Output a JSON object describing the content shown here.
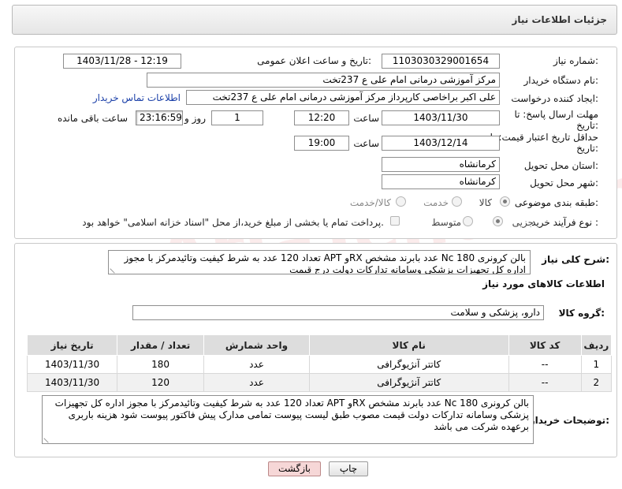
{
  "header": {
    "title": "جزئیات اطلاعات نیاز"
  },
  "fields": {
    "need_number_label": "شماره نیاز:",
    "need_number": "1103030329001654",
    "announce_label": "تاریخ و ساعت اعلان عمومی:",
    "announce_value": "1403/11/28 - 12:19",
    "buyer_org_label": "نام دستگاه خریدار:",
    "buyer_org": "مرکز آموزشی درمانی امام علی ع 237تخت",
    "requester_label": "ایجاد کننده درخواست:",
    "requester": "علی اکبر براخاصی کارپرداز  مرکز آموزشی درمانی امام علی ع 237تخت",
    "buyer_contact_link": "اطلاعات تماس خریدار",
    "reply_deadline_label": "مهلت ارسال پاسخ: تا",
    "reply_deadline_label2": "تاریخ:",
    "reply_date": "1403/11/30",
    "time_label": "ساعت",
    "reply_time": "12:20",
    "day_value": "1",
    "day_and_label": "روز و",
    "remaining_time": "23:16:59",
    "remaining_label": "ساعت باقی مانده",
    "price_validity_label": "حداقل تاریخ اعتبار قیمت: تا",
    "price_validity_label2": "تاریخ:",
    "price_date": "1403/12/14",
    "price_time": "19:00",
    "province_label": "استان محل تحویل:",
    "province": "کرمانشاه",
    "city_label": "شهر محل تحویل:",
    "city": "کرمانشاه",
    "category_label": "طبقه بندی موضوعی:",
    "category_options": [
      "کالا",
      "خدمت",
      "کالا/خدمت"
    ],
    "category_selected": "کالا",
    "process_label": "نوع فرآیند خرید :",
    "process_options": [
      "جزیی",
      "متوسط"
    ],
    "payment_note": "پرداخت تمام یا بخشی از مبلغ خرید،از محل \"اسناد خزانه اسلامی\" خواهد بود."
  },
  "description": {
    "label": "شرح کلی نیاز:",
    "text": "بالن کرونری Nc  180 عدد بابرند مشخص  RXو APT تعداد 120 عدد به شرط کیفیت وتائیدمرکز با مجوز اداره کل تجهیزات پزشکی وسامانه تدارکات دولت درج قیمت"
  },
  "goods": {
    "section_title": "اطلاعات کالاهای مورد نیاز",
    "group_label": "گروه کالا:",
    "group_value": "دارو، پزشکی و سلامت",
    "columns": [
      "ردیف",
      "کد کالا",
      "نام کالا",
      "واحد شمارش",
      "تعداد / مقدار",
      "تاریخ نیاز"
    ],
    "rows": [
      [
        "1",
        "--",
        "کاتتر آنژیوگرافی",
        "عدد",
        "180",
        "1403/11/30"
      ],
      [
        "2",
        "--",
        "کاتتر آنژیوگرافی",
        "عدد",
        "120",
        "1403/11/30"
      ]
    ]
  },
  "buyer_notes": {
    "label": "توضیحات خریدار:",
    "text": "بالن کرونری Nc  180 عدد بابرند مشخص  RXو APT تعداد 120 عدد به شرط کیفیت وتائیدمرکز با مجوز اداره کل تجهیزات پزشکی وسامانه تدارکات دولت قیمت مصوب طبق لیست پیوست تمامی مدارک پیش فاکتور پیوست شود هزینه باربری برعهده شرکت می باشد"
  },
  "buttons": {
    "print": "چاپ",
    "back": "بازگشت"
  },
  "watermark": "AriaTender.net"
}
